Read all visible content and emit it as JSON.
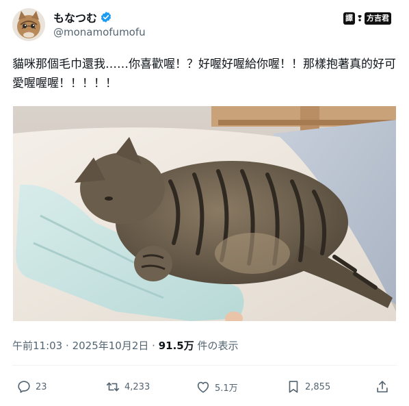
{
  "user": {
    "display_name": "もなつむ",
    "handle": "@monamofumofu",
    "verified": true,
    "avatar_icon": "cat-avatar-icon"
  },
  "translator": {
    "label_left": "譯",
    "separator": "❢",
    "label_right": "方吉君"
  },
  "post": {
    "text": "貓咪那個毛巾還我……你喜歡喔！？好喔好喔給你喔！！那樣抱著真的好可愛喔喔喔！！！！！"
  },
  "meta": {
    "time": "午前11:03",
    "dot": "·",
    "date": "2025年10月2日",
    "views_count": "91.5万",
    "views_label": "件の表示"
  },
  "actions": {
    "replies": "23",
    "reposts": "4,233",
    "likes": "5.1万",
    "bookmarks": "2,855"
  },
  "colors": {
    "verified_blue": "#1d9bf0",
    "text_primary": "#0f1419",
    "text_secondary": "#536471"
  },
  "icons": {
    "reply": "reply-icon",
    "repost": "repost-icon",
    "like": "heart-icon",
    "bookmark": "bookmark-icon",
    "share": "share-icon",
    "verified": "verified-badge-icon"
  }
}
